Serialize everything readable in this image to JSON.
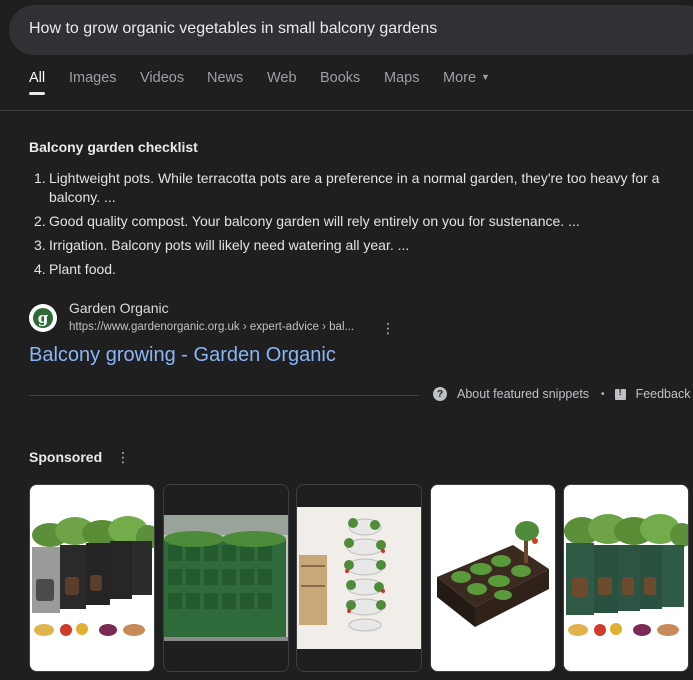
{
  "search": {
    "query": "How to grow organic vegetables in small balcony gardens"
  },
  "tabs": [
    {
      "label": "All",
      "active": true
    },
    {
      "label": "Images"
    },
    {
      "label": "Videos"
    },
    {
      "label": "News"
    },
    {
      "label": "Web"
    },
    {
      "label": "Books"
    },
    {
      "label": "Maps"
    },
    {
      "label": "More"
    }
  ],
  "snippet": {
    "title": "Balcony garden checklist",
    "items": [
      {
        "num": "1.",
        "text": "Lightweight pots. While terracotta pots are a preference in a normal garden, they're too heavy for a balcony. ..."
      },
      {
        "num": "2.",
        "text": "Good quality compost. Your balcony garden will rely entirely on you for sustenance. ..."
      },
      {
        "num": "3.",
        "text": "Irrigation. Balcony pots will likely need watering all year. ..."
      },
      {
        "num": "4.",
        "text": "Plant food."
      }
    ],
    "source": {
      "favicon_letter": "g",
      "name": "Garden Organic",
      "url": "https://www.gardenorganic.org.uk › expert-advice › bal...",
      "link_title": "Balcony growing - Garden Organic"
    },
    "footer": {
      "about": "About featured snippets",
      "separator": "•",
      "feedback": "Feedback"
    }
  },
  "sponsored": {
    "label": "Sponsored",
    "products": [
      {
        "icon": "grow-bags-image"
      },
      {
        "icon": "wall-planter-image"
      },
      {
        "icon": "vertical-tower-planter-image"
      },
      {
        "icon": "raised-bed-image"
      },
      {
        "icon": "grow-bags-image"
      }
    ]
  },
  "colors": {
    "background": "#1f1f1f",
    "search_bar": "#303134",
    "link": "#8ab4f8",
    "text": "#e3e3e3",
    "muted": "#9aa0a6"
  }
}
